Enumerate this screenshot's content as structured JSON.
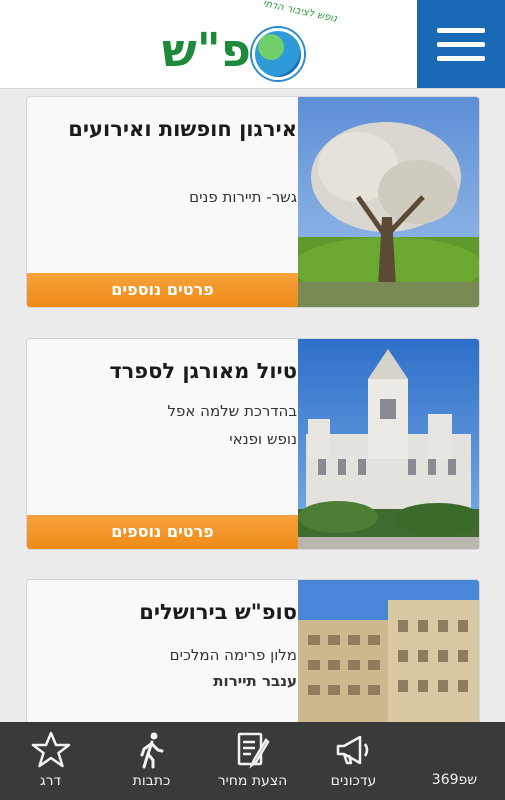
{
  "header": {
    "logo_text": "סופ\"ש",
    "logo_tagline": "נופש לציבור הדתי",
    "menu_icon": "hamburger-icon",
    "brand_color": "#1a69b4"
  },
  "cards": [
    {
      "title": "אירגון חופשות ואירועים",
      "lines": [
        "גשר- תיירות פנים"
      ],
      "button": "פרטים נוספים"
    },
    {
      "title": "טיול מאורגן לספרד",
      "lines": [
        "בהדרכת שלמה אפל",
        "נופש ופנאי"
      ],
      "button": "פרטים נוספים"
    },
    {
      "title": "סופ\"ש בירושלים",
      "lines": [
        "מלון פרימה המלכים",
        "ענבר תיירות"
      ]
    }
  ],
  "nav": {
    "items": [
      {
        "label": "עדכונים",
        "icon": "megaphone-icon"
      },
      {
        "label": "הצעת מחיר",
        "icon": "form-pen-icon"
      },
      {
        "label": "כתבות",
        "icon": "walking-person-icon"
      },
      {
        "label": "דרג",
        "icon": "star-icon"
      }
    ],
    "brand": "369שפ"
  },
  "colors": {
    "accent_orange": "#ee8b17",
    "nav_background": "#3a3a3a"
  }
}
